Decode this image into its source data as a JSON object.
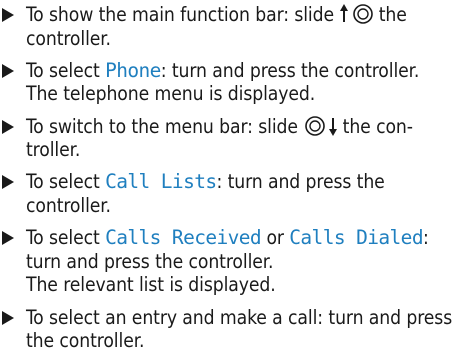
{
  "steps": [
    {
      "parts": [
        {
          "t": "To show the main function bar: slide "
        },
        {
          "icon": "controller-slide-up-icon"
        },
        {
          "t": " the controller."
        }
      ]
    },
    {
      "parts": [
        {
          "t": "To select "
        },
        {
          "tok": "Phone"
        },
        {
          "t": ": turn and press the controller."
        },
        {
          "br": true
        },
        {
          "t": "The telephone menu is displayed."
        }
      ]
    },
    {
      "parts": [
        {
          "t": "To switch to the menu bar: slide "
        },
        {
          "icon": "controller-slide-down-icon"
        },
        {
          "t": " the con-troller."
        }
      ]
    },
    {
      "parts": [
        {
          "t": "To select "
        },
        {
          "tok": "Call Lists"
        },
        {
          "t": ": turn and press the controller."
        }
      ]
    },
    {
      "parts": [
        {
          "t": "To select "
        },
        {
          "tok": "Calls Received"
        },
        {
          "t": " or "
        },
        {
          "tok": "Calls Dialed"
        },
        {
          "t": ": turn and press the controller."
        },
        {
          "br": true
        },
        {
          "t": "The relevant list is displayed."
        }
      ]
    },
    {
      "parts": [
        {
          "t": "To select an entry and make a call: turn and press the controller."
        }
      ]
    }
  ],
  "colors": {
    "text": "#1a1a1a",
    "menu_item": "#1f7fbf"
  }
}
